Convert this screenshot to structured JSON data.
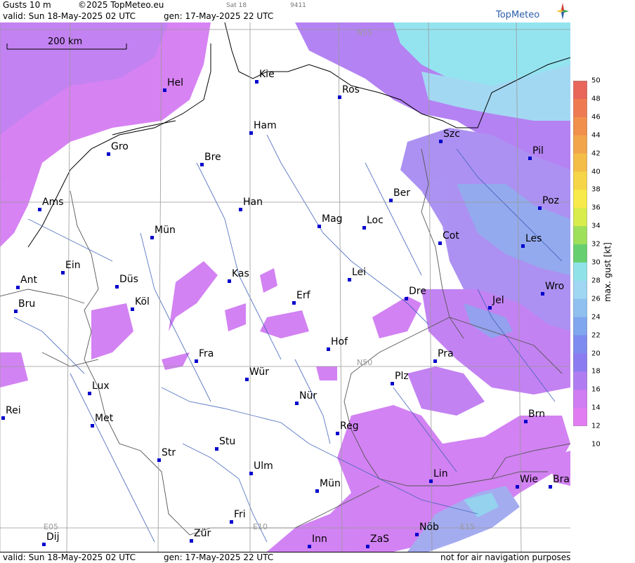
{
  "header": {
    "title": "Gusts 10 m",
    "copyright": "©2025 TopMeteo.eu",
    "sat_label": "Sat 18",
    "code": "9411",
    "valid": "valid:  Sun  18-May-2025  02 UTC",
    "gen": "gen: 17-May-2025 22 UTC",
    "logo": "TopMeteo"
  },
  "footer": {
    "valid": "valid:  Sun  18-May-2025  02 UTC",
    "gen": "gen: 17-May-2025 22 UTC",
    "note": "not for air navigation purposes"
  },
  "scale": {
    "label": "200 km"
  },
  "grid_labels": {
    "n55": "N55",
    "n50": "N50",
    "e05": "E05",
    "e10": "E10",
    "e15": "E15"
  },
  "colorbar": {
    "unit": "max. gust  [kt]",
    "ticks": [
      "50",
      "48",
      "46",
      "44",
      "42",
      "40",
      "38",
      "36",
      "34",
      "32",
      "30",
      "28",
      "26",
      "24",
      "22",
      "20",
      "18",
      "16",
      "14",
      "12",
      "10"
    ],
    "colors": [
      "#e8665a",
      "#ee7a52",
      "#f0904c",
      "#f2a54a",
      "#f4bd48",
      "#f6d548",
      "#f8ea4a",
      "#d8ec4c",
      "#9ee05a",
      "#66d070",
      "#8fe3e8",
      "#9fd6f2",
      "#8fc0f0",
      "#7fa6ee",
      "#7e8cf0",
      "#8c7cf2",
      "#b07cf2",
      "#d07cf2",
      "#e27cf2"
    ]
  },
  "cities": [
    {
      "name": "Kie"
    },
    {
      "name": "Hel"
    },
    {
      "name": "Ros"
    },
    {
      "name": "Ham"
    },
    {
      "name": "Gro"
    },
    {
      "name": "Bre"
    },
    {
      "name": "Szc"
    },
    {
      "name": "Pil"
    },
    {
      "name": "Ber"
    },
    {
      "name": "Ams"
    },
    {
      "name": "Han"
    },
    {
      "name": "Poz"
    },
    {
      "name": "Mag"
    },
    {
      "name": "Loc"
    },
    {
      "name": "Mün"
    },
    {
      "name": "Cot"
    },
    {
      "name": "Les"
    },
    {
      "name": "Ein"
    },
    {
      "name": "Kas"
    },
    {
      "name": "Lei"
    },
    {
      "name": "Ant"
    },
    {
      "name": "Düs"
    },
    {
      "name": "Wro"
    },
    {
      "name": "Dre"
    },
    {
      "name": "Erf"
    },
    {
      "name": "Köl"
    },
    {
      "name": "Jel"
    },
    {
      "name": "Bru"
    },
    {
      "name": "Hof"
    },
    {
      "name": "Fra"
    },
    {
      "name": "Pra"
    },
    {
      "name": "Wür"
    },
    {
      "name": "Plz"
    },
    {
      "name": "Lux"
    },
    {
      "name": "Nür"
    },
    {
      "name": "Rei"
    },
    {
      "name": "Brn"
    },
    {
      "name": "Met"
    },
    {
      "name": "Reg"
    },
    {
      "name": "Stu"
    },
    {
      "name": "Str"
    },
    {
      "name": "Lin"
    },
    {
      "name": "Ulm"
    },
    {
      "name": "Wie"
    },
    {
      "name": "Bra"
    },
    {
      "name": "Mün"
    },
    {
      "name": "Fri"
    },
    {
      "name": "Nöb"
    },
    {
      "name": "Dij"
    },
    {
      "name": "Zür"
    },
    {
      "name": "Inn"
    },
    {
      "name": "ZaS"
    }
  ]
}
